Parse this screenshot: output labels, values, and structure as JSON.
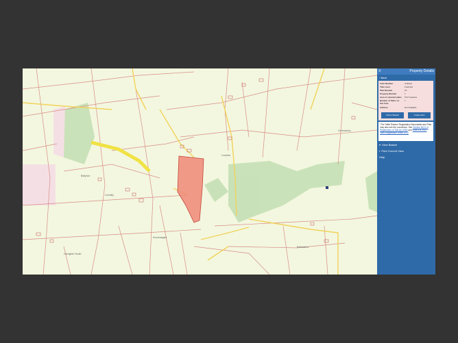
{
  "panel": {
    "menu_icon": "hamburger-icon",
    "title": "Property Details",
    "back_label": "Back",
    "details": [
      {
        "label": "Folio Number",
        "value": "Unlisted"
      },
      {
        "label": "Title Level",
        "value": "Freehold"
      },
      {
        "label": "Plan Number",
        "value": "15"
      },
      {
        "label": "Property Number",
        "value": "1"
      },
      {
        "label": "Area of selected plans",
        "value": "5.67 hectares"
      },
      {
        "label": "Number of Plans on this folio",
        "value": "1"
      },
      {
        "label": "Address",
        "value": "Not Available"
      }
    ],
    "add_to_basket_label": "Add to Basket",
    "create_alert_label": "Create Alert",
    "note_text": "*The Tailte Éireann Registration Boundaries and Plan may also see the conclusive. See ",
    "note_link1": "Section 62(1) of Registration of Title Act 1964",
    "note_mid": " and ",
    "note_link2": "Rule 8 of 2012 Land Registration Rules 2012",
    "view_basket_label": "View Basket",
    "print_label": "Print Current View",
    "help_label": "Help"
  },
  "map": {
    "labels": [
      "Coolinfa",
      "Ballyhoe",
      "Knocknagaul",
      "Ballindarra",
      "Gortnaclohy",
      "Carrigeen South",
      "Corbally"
    ]
  },
  "colors": {
    "selected_parcel": "#f08878",
    "panel_bg": "#2f6aa8",
    "map_bg": "#f3f7df",
    "forest": "#bfdcb0"
  }
}
